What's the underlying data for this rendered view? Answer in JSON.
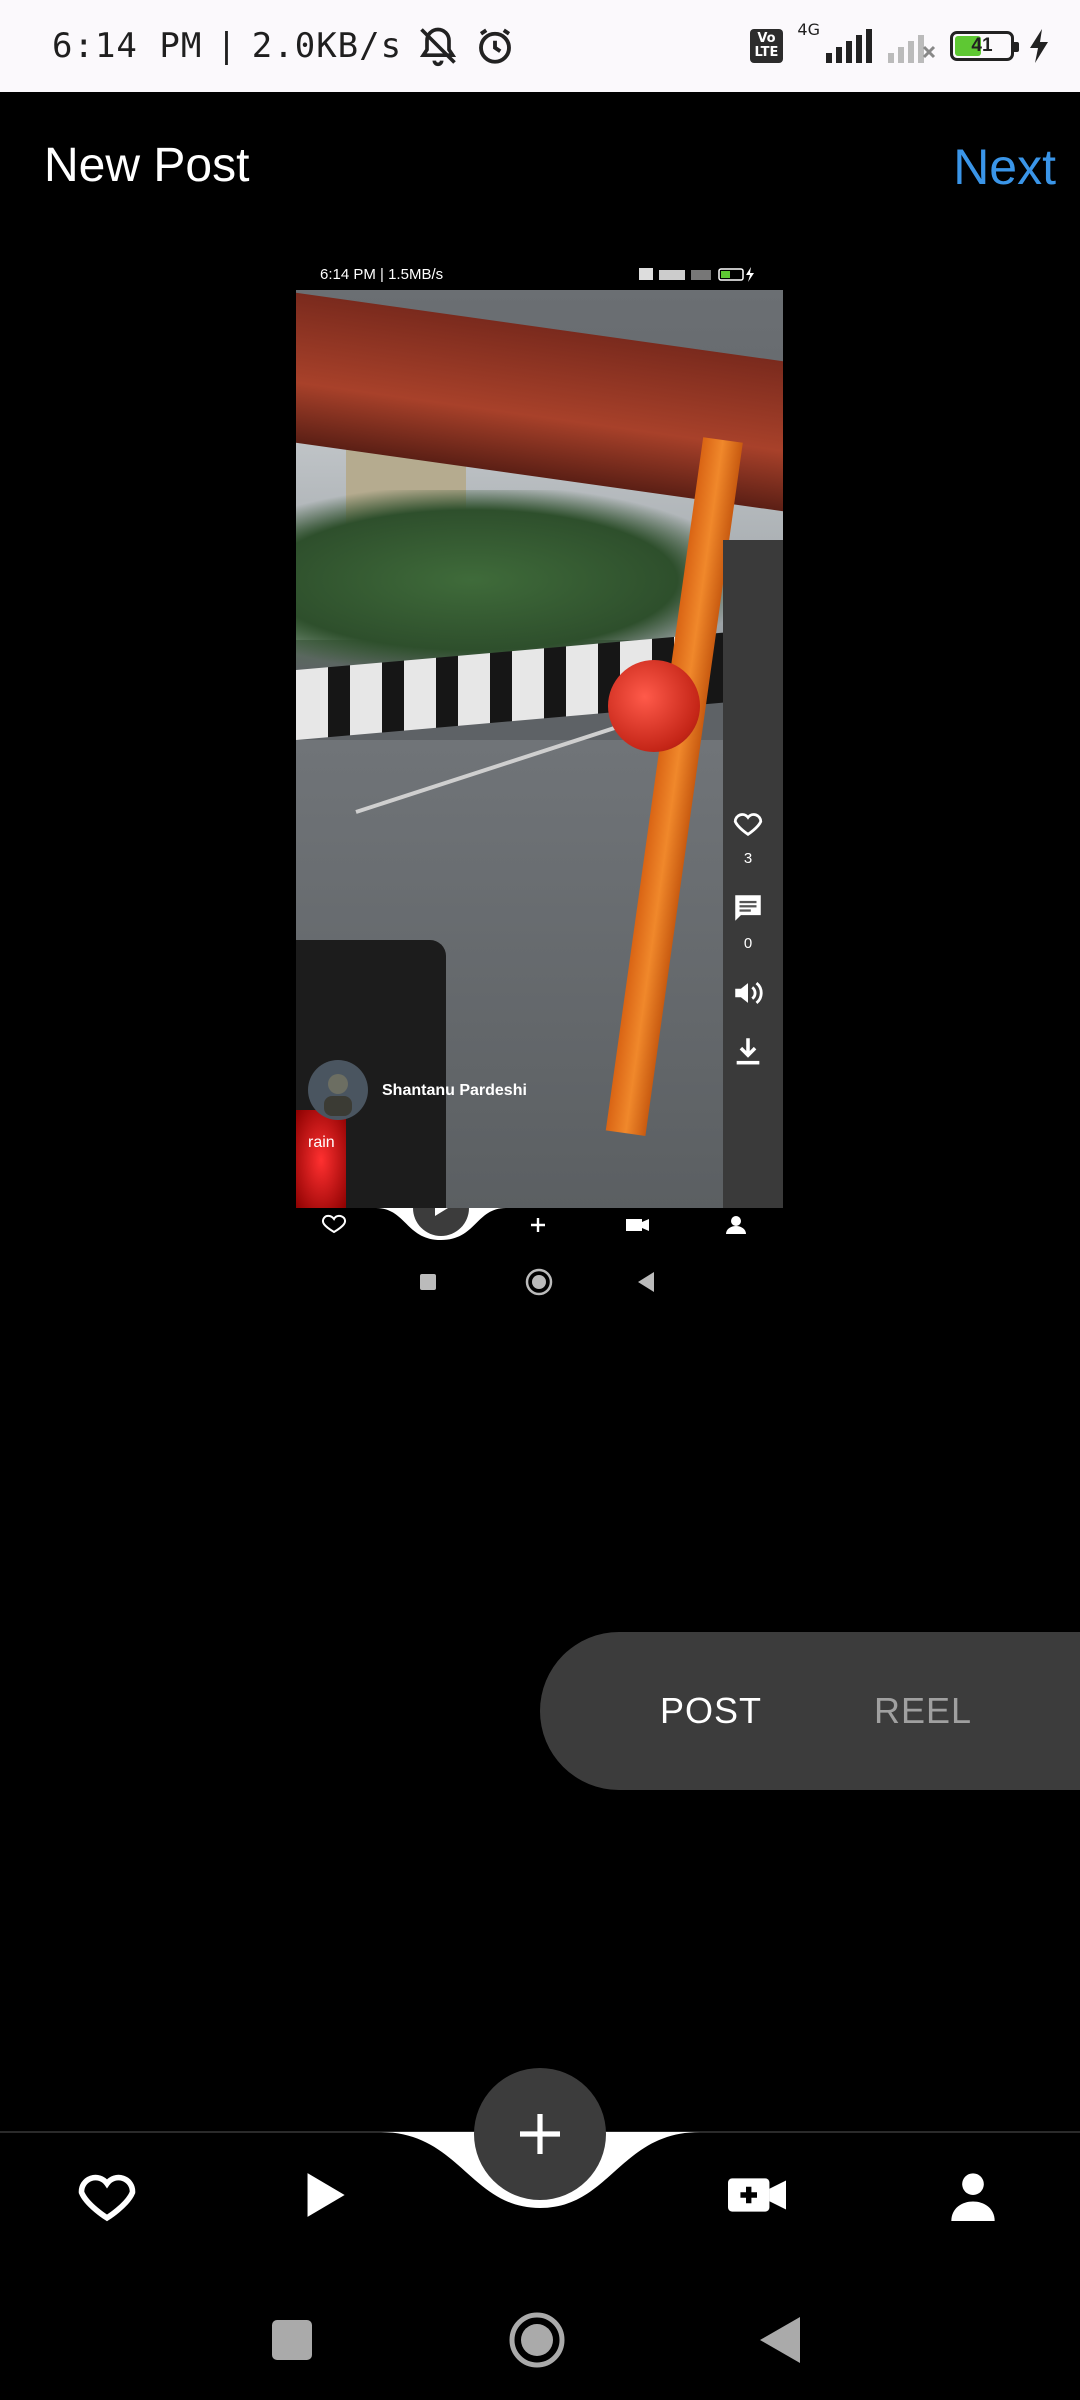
{
  "status_bar": {
    "time": "6:14 PM",
    "speed": "2.0KB/s",
    "volte": "Vo\nLTE",
    "network": "4G",
    "battery": "41"
  },
  "header": {
    "title": "New Post",
    "next_label": "Next"
  },
  "preview": {
    "status_time": "6:14 PM | 1.5MB/s",
    "like_count": "3",
    "comment_count": "0",
    "username": "Shantanu Pardeshi",
    "caption": "rain"
  },
  "mode_switch": {
    "post_label": "POST",
    "reel_label": "REEL",
    "selected": "POST"
  },
  "bottom_nav": {
    "items": [
      "heart-icon",
      "play-icon",
      "add-icon",
      "video-add-icon",
      "person-icon"
    ]
  },
  "colors": {
    "accent": "#3a95e8",
    "background": "#000000",
    "pill": "#3c3c3c"
  }
}
